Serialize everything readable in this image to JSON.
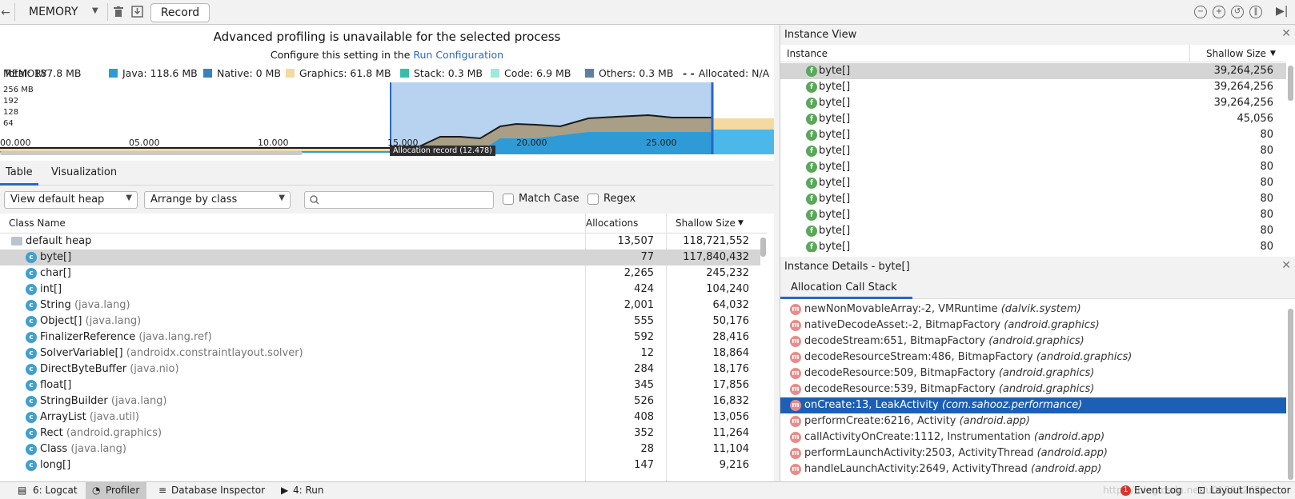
{
  "toolbar": {
    "back_glyph": "←",
    "process": "MEMORY",
    "record_label": "Record"
  },
  "banner": {
    "title": "Advanced profiling is unavailable for the selected process",
    "subtitle_prefix": "Configure this setting in the",
    "subtitle_link": "Run Configuration"
  },
  "legend": {
    "memory_label": "MEMORY",
    "total": "Total: 187.8 MB",
    "java": "Java: 118.6 MB",
    "native": "Native: 0 MB",
    "graphics": "Graphics: 61.8 MB",
    "stack": "Stack: 0.3 MB",
    "code": "Code: 6.9 MB",
    "others": "Others: 0.3 MB",
    "allocated": "Allocated: N/A",
    "colors": {
      "java": "#2f9bd6",
      "native": "#3a7fbf",
      "graphics": "#f4d9a0",
      "stack": "#35bfa9",
      "code": "#9fe8dd",
      "others": "#5f7f9f"
    }
  },
  "chart_data": {
    "type": "area",
    "y_ticks": [
      "256 MB",
      "192",
      "128",
      "64"
    ],
    "x_ticks": [
      "00.000",
      "05.000",
      "10.000",
      "15.000",
      "20.000",
      "25.000"
    ],
    "selection_label": "Allocation record (12.478)"
  },
  "tabs": {
    "table": "Table",
    "visualization": "Visualization"
  },
  "filters": {
    "heap": "View default heap",
    "arrange": "Arrange by class",
    "match_case": "Match Case",
    "regex": "Regex"
  },
  "table": {
    "headers": {
      "class_name": "Class Name",
      "allocations": "Allocations",
      "shallow_size": "Shallow Size"
    },
    "rows": [
      {
        "name": "default heap",
        "pkg": "",
        "alloc": "13,507",
        "size": "118,721,552"
      },
      {
        "name": "byte[]",
        "pkg": "",
        "alloc": "77",
        "size": "117,840,432"
      },
      {
        "name": "char[]",
        "pkg": "",
        "alloc": "2,265",
        "size": "245,232"
      },
      {
        "name": "int[]",
        "pkg": "",
        "alloc": "424",
        "size": "104,240"
      },
      {
        "name": "String",
        "pkg": "(java.lang)",
        "alloc": "2,001",
        "size": "64,032"
      },
      {
        "name": "Object[]",
        "pkg": "(java.lang)",
        "alloc": "555",
        "size": "50,176"
      },
      {
        "name": "FinalizerReference",
        "pkg": "(java.lang.ref)",
        "alloc": "592",
        "size": "28,416"
      },
      {
        "name": "SolverVariable[]",
        "pkg": "(androidx.constraintlayout.solver)",
        "alloc": "12",
        "size": "18,864"
      },
      {
        "name": "DirectByteBuffer",
        "pkg": "(java.nio)",
        "alloc": "284",
        "size": "18,176"
      },
      {
        "name": "float[]",
        "pkg": "",
        "alloc": "345",
        "size": "17,856"
      },
      {
        "name": "StringBuilder",
        "pkg": "(java.lang)",
        "alloc": "526",
        "size": "16,832"
      },
      {
        "name": "ArrayList",
        "pkg": "(java.util)",
        "alloc": "408",
        "size": "13,056"
      },
      {
        "name": "Rect",
        "pkg": "(android.graphics)",
        "alloc": "352",
        "size": "11,264"
      },
      {
        "name": "Class",
        "pkg": "(java.lang)",
        "alloc": "28",
        "size": "11,104"
      },
      {
        "name": "long[]",
        "pkg": "",
        "alloc": "147",
        "size": "9,216"
      }
    ]
  },
  "instance_view": {
    "title": "Instance View",
    "col_instance": "Instance",
    "col_size": "Shallow Size",
    "rows": [
      {
        "name": "byte[]",
        "size": "39,264,256"
      },
      {
        "name": "byte[]",
        "size": "39,264,256"
      },
      {
        "name": "byte[]",
        "size": "39,264,256"
      },
      {
        "name": "byte[]",
        "size": "45,056"
      },
      {
        "name": "byte[]",
        "size": "80"
      },
      {
        "name": "byte[]",
        "size": "80"
      },
      {
        "name": "byte[]",
        "size": "80"
      },
      {
        "name": "byte[]",
        "size": "80"
      },
      {
        "name": "byte[]",
        "size": "80"
      },
      {
        "name": "byte[]",
        "size": "80"
      },
      {
        "name": "byte[]",
        "size": "80"
      },
      {
        "name": "byte[]",
        "size": "80"
      }
    ]
  },
  "instance_details": {
    "title": "Instance Details - byte[]",
    "tab": "Allocation Call Stack",
    "frames": [
      {
        "method": "newNonMovableArray:-2, VMRuntime",
        "pkg": "(dalvik.system)"
      },
      {
        "method": "nativeDecodeAsset:-2, BitmapFactory",
        "pkg": "(android.graphics)"
      },
      {
        "method": "decodeStream:651, BitmapFactory",
        "pkg": "(android.graphics)"
      },
      {
        "method": "decodeResourceStream:486, BitmapFactory",
        "pkg": "(android.graphics)"
      },
      {
        "method": "decodeResource:509, BitmapFactory",
        "pkg": "(android.graphics)"
      },
      {
        "method": "decodeResource:539, BitmapFactory",
        "pkg": "(android.graphics)"
      },
      {
        "method": "onCreate:13, LeakActivity",
        "pkg": "(com.sahooz.performance)"
      },
      {
        "method": "performCreate:6216, Activity",
        "pkg": "(android.app)"
      },
      {
        "method": "callActivityOnCreate:1112, Instrumentation",
        "pkg": "(android.app)"
      },
      {
        "method": "performLaunchActivity:2503, ActivityThread",
        "pkg": "(android.app)"
      },
      {
        "method": "handleLaunchActivity:2649, ActivityThread",
        "pkg": "(android.app)"
      }
    ]
  },
  "statusbar": {
    "logcat": "6: Logcat",
    "profiler": "Profiler",
    "database": "Database Inspector",
    "run": "4: Run",
    "watermark": "https://blog.csdn.net/u013062621",
    "event_count": "1",
    "event_log": "Event Log",
    "layout_inspector": "Layout Inspector"
  }
}
